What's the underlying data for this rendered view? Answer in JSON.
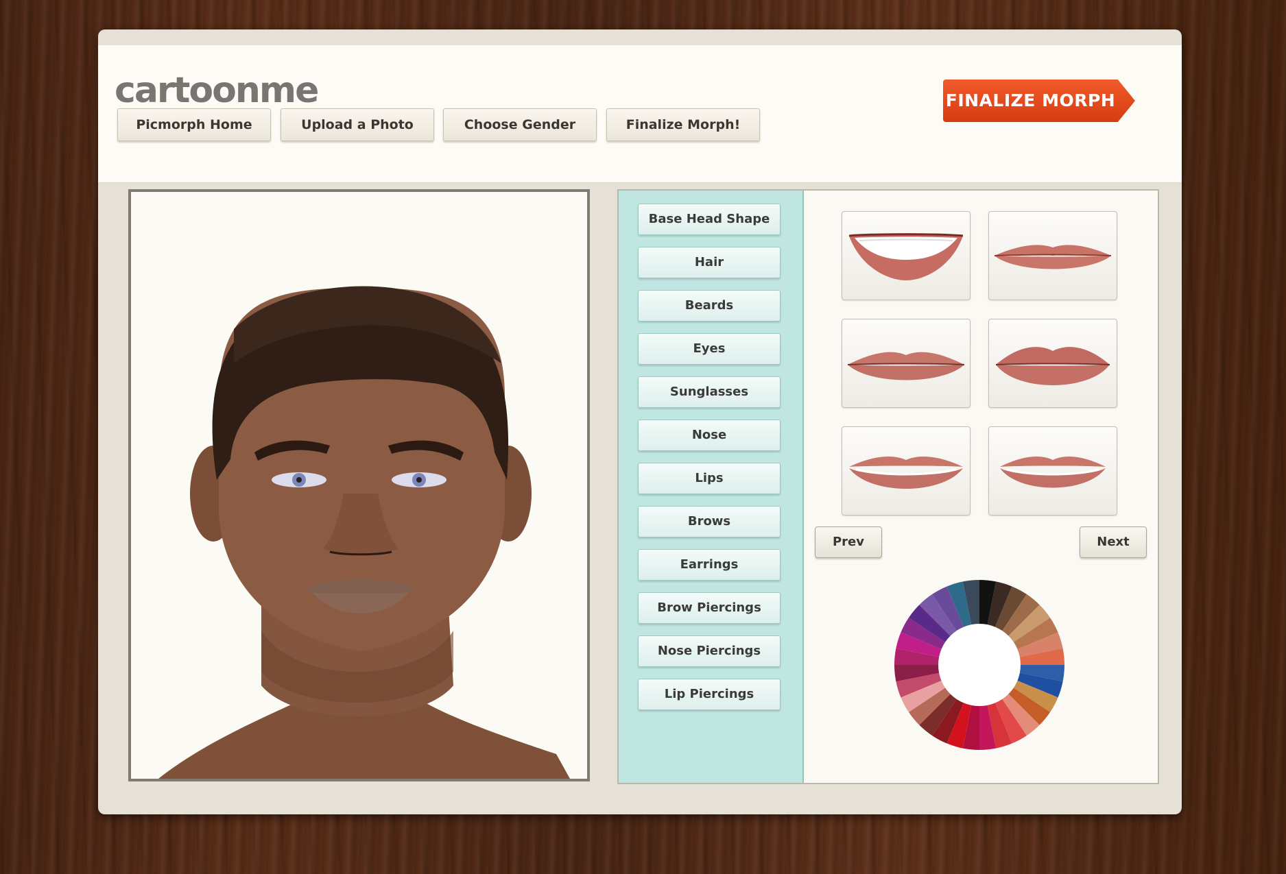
{
  "logo": "cartoonme",
  "nav": {
    "items": [
      "Picmorph Home",
      "Upload a Photo",
      "Choose Gender",
      "Finalize Morph!"
    ]
  },
  "cta": {
    "label": "FINALIZE MORPH"
  },
  "categories": [
    "Base Head Shape",
    "Hair",
    "Beards",
    "Eyes",
    "Sunglasses",
    "Nose",
    "Lips",
    "Brows",
    "Earrings",
    "Brow Piercings",
    "Nose Piercings",
    "Lip Piercings"
  ],
  "pagination": {
    "prev": "Prev",
    "next": "Next"
  },
  "thumbnails": [
    {
      "name": "lips-smile-teeth"
    },
    {
      "name": "lips-thin-closed"
    },
    {
      "name": "lips-medium-closed"
    },
    {
      "name": "lips-full-closed"
    },
    {
      "name": "lips-parted-teeth"
    },
    {
      "name": "lips-parted-teeth-small"
    }
  ],
  "colors": {
    "lip": "#c9756a",
    "skin": "#8a5a40",
    "hair": "#2e1d14",
    "accent": "#e8501e",
    "category_panel": "#bfe6e1"
  },
  "color_wheel": [
    "#121212",
    "#3a2a22",
    "#6b4a34",
    "#9c6b4a",
    "#c99a6e",
    "#b8764f",
    "#d9826a",
    "#e06a4a",
    "#2f5ea8",
    "#1f4fa0",
    "#c8904a",
    "#c65c28",
    "#e48b7a",
    "#e24a4a",
    "#d6333a",
    "#c2185b",
    "#b01040",
    "#d4121e",
    "#8a1a20",
    "#7a2d2a",
    "#b66a5a",
    "#e8a0a0",
    "#c24a6a",
    "#8c1e4a",
    "#b0226a",
    "#c21e8a",
    "#8a2a8a",
    "#5a2a8a",
    "#7a5aa8",
    "#6a4a9a",
    "#2e6a8a",
    "#3a4a5a"
  ]
}
